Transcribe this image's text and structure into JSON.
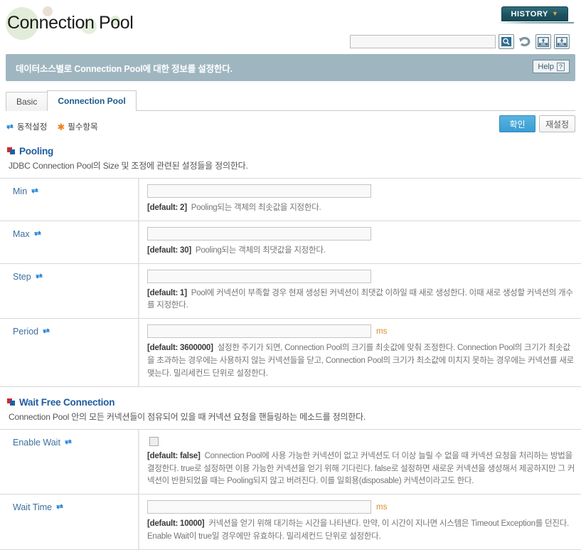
{
  "header": {
    "page_title": "Connection Pool",
    "history_button": "HISTORY",
    "history_chevron_icon": "chevron-down-icon",
    "search_placeholder": "",
    "search_value": "",
    "icons": [
      {
        "name": "search-icon",
        "title": "Search"
      },
      {
        "name": "refresh-icon",
        "title": "Refresh"
      },
      {
        "name": "xml-upload-icon",
        "title": "XML Upload"
      },
      {
        "name": "xml-download-icon",
        "title": "XML Download"
      }
    ]
  },
  "banner": {
    "text": "데이터소스별로 Connection Pool에 대한 정보를 설정한다.",
    "help_label": "Help",
    "help_icon": "question-mark-icon"
  },
  "tabs": [
    {
      "label": "Basic",
      "active": false
    },
    {
      "label": "Connection Pool",
      "active": true
    }
  ],
  "legend": [
    {
      "icon": "sync-icon",
      "label": "동적설정"
    },
    {
      "icon": "asterisk-icon",
      "label": "필수항목"
    }
  ],
  "actions": {
    "confirm_label": "확인",
    "reset_label": "재설정"
  },
  "sections": [
    {
      "title": "Pooling",
      "description": "JDBC Connection Pool의 Size 및 조정에 관련된 설정들을 정의한다.",
      "fields": [
        {
          "label": "Min",
          "dynamic": true,
          "control": "text",
          "value": "",
          "unit": "",
          "default_label": "[default: 2]",
          "description": "Pooling되는 객체의 최솟값을 지정한다."
        },
        {
          "label": "Max",
          "dynamic": true,
          "control": "text",
          "value": "",
          "unit": "",
          "default_label": "[default: 30]",
          "description": "Pooling되는 객체의 최댓값을 지정한다."
        },
        {
          "label": "Step",
          "dynamic": true,
          "control": "text",
          "value": "",
          "unit": "",
          "default_label": "[default: 1]",
          "description": "Pool에 커넥션이 부족할 경우 현재 생성된 커넥션이 최댓값 이하일 때 새로 생성한다. 이때 새로 생성할 커넥션의 개수를 지정한다."
        },
        {
          "label": "Period",
          "dynamic": true,
          "control": "text",
          "value": "",
          "unit": "ms",
          "default_label": "[default: 3600000]",
          "description": "설정한 주기가 되면, Connection Pool의 크기를 최솟값에 맞춰 조정한다. Connection Pool의 크기가 최솟값을 초과하는 경우에는 사용하지 않는 커넥션들을 닫고, Connection Pool의 크기가 최소값에 미치지 못하는 경우에는 커넥션를 새로 맺는다. 밀리세컨드 단위로 설정한다."
        }
      ]
    },
    {
      "title": "Wait Free Connection",
      "description": "Connection Pool 안의 모든 커넥션들이 점유되어 있을 때 커넥션 요청을 핸들링하는 메소드를 정의한다.",
      "fields": [
        {
          "label": "Enable Wait",
          "dynamic": true,
          "control": "checkbox",
          "checked": false,
          "unit": "",
          "default_label": "[default: false]",
          "description": "Connection Pool에 사용 가능한 커넥션이 없고 커넥션도 더 이상 늘릴 수 없을 때 커넥션 요청을 처리하는 방법을 결정한다. true로 설정하면 이용 가능한 커넥션을 얻기 위해 기다린다. false로 설정하면 새로운 커넥션을 생성해서 제공하지만 그 커넥션이 반환되었을 때는 Pooling되지 않고 버려진다. 이를 일회용(disposable) 커넥션이라고도 한다."
        },
        {
          "label": "Wait Time",
          "dynamic": true,
          "control": "text",
          "value": "",
          "unit": "ms",
          "default_label": "[default: 10000]",
          "description": "커넥션을 얻기 위해 대기하는 시간을 나타낸다. 만약, 이 시간이 지나면 시스템은 Timeout Exception를 던진다. Enable Wait이 true일 경우에만 유효하다. 밀리세컨드 단위로 설정한다."
        }
      ]
    }
  ],
  "colors": {
    "banner_bg": "#9fb6c0",
    "section_title": "#1d5b9e",
    "field_label": "#3c6fa0",
    "unit": "#d98c26",
    "primary_button": "#3a9ed4",
    "history_button": "#1d5462",
    "accent_orange": "#f08020"
  }
}
